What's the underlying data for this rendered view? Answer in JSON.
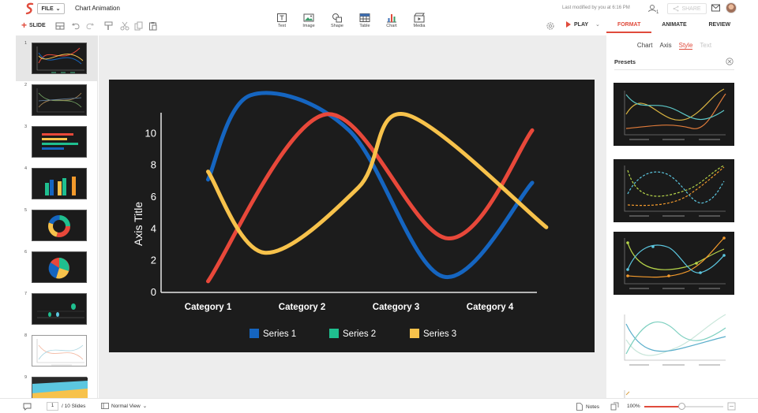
{
  "app": {
    "file_label": "FILE",
    "doc_title": "Chart Animation",
    "last_modified": "Last modified by you at 6:16 PM",
    "collaborator_count": "1",
    "share_label": "SHARE"
  },
  "toolbar": {
    "slide_label": "SLIDE",
    "play_label": "PLAY",
    "insert": [
      {
        "id": "text",
        "label": "Text",
        "icon": "text-icon"
      },
      {
        "id": "image",
        "label": "Image",
        "icon": "image-icon"
      },
      {
        "id": "shape",
        "label": "Shape",
        "icon": "shape-icon"
      },
      {
        "id": "table",
        "label": "Table",
        "icon": "table-icon"
      },
      {
        "id": "chart",
        "label": "Chart",
        "icon": "chart-icon"
      },
      {
        "id": "media",
        "label": "Media",
        "icon": "media-icon"
      }
    ]
  },
  "right_tabs": [
    {
      "label": "FORMAT",
      "active": true
    },
    {
      "label": "ANIMATE",
      "active": false
    },
    {
      "label": "REVIEW",
      "active": false
    }
  ],
  "format_subtabs": [
    {
      "label": "Chart",
      "state": "normal"
    },
    {
      "label": "Axis",
      "state": "normal"
    },
    {
      "label": "Style",
      "state": "active"
    },
    {
      "label": "Text",
      "state": "disabled"
    }
  ],
  "presets_title": "Presets",
  "slides": [
    {
      "num": "1",
      "kind": "line",
      "active": true
    },
    {
      "num": "2",
      "kind": "line-dim",
      "active": false
    },
    {
      "num": "3",
      "kind": "hbar",
      "active": false
    },
    {
      "num": "4",
      "kind": "vbar",
      "active": false
    },
    {
      "num": "5",
      "kind": "donut",
      "active": false
    },
    {
      "num": "6",
      "kind": "pie",
      "active": false
    },
    {
      "num": "7",
      "kind": "dots",
      "active": false
    },
    {
      "num": "8",
      "kind": "light-line",
      "active": false
    },
    {
      "num": "9",
      "kind": "area",
      "active": false
    }
  ],
  "status": {
    "page_current": "1",
    "page_total": "/ 10 Slides",
    "view_mode": "Normal View",
    "notes_label": "Notes",
    "zoom": "100%",
    "zoom_fraction": 0.47
  },
  "colors": {
    "accent": "#e04b3c",
    "series1": "#1565c0",
    "series2": "#1fbf8f",
    "series3": "#f7c24b",
    "series_red": "#e8483a"
  },
  "chart_data": {
    "type": "line",
    "categories": [
      "Category 1",
      "Category 2",
      "Category 3",
      "Category 4"
    ],
    "ylabel": "Axis Title",
    "xlabel": "",
    "yticks": [
      0,
      2,
      4,
      6,
      8,
      10
    ],
    "ylim": [
      0,
      12
    ],
    "legend": [
      {
        "name": "Series 1",
        "color": "#1565c0"
      },
      {
        "name": "Series 2",
        "color": "#1fbf8f"
      },
      {
        "name": "Series 3",
        "color": "#f7c24b"
      }
    ],
    "legend_position": "bottom",
    "curves": [
      {
        "color": "#1565c0",
        "points": [
          [
            0,
            7.1
          ],
          [
            0.45,
            12.4
          ],
          [
            1.5,
            10.2
          ],
          [
            2.5,
            1.0
          ],
          [
            3.45,
            6.9
          ]
        ]
      },
      {
        "color": "#e8483a",
        "points": [
          [
            0,
            0.7
          ],
          [
            1.25,
            11.2
          ],
          [
            2.55,
            3.4
          ],
          [
            3.45,
            10.2
          ]
        ]
      },
      {
        "color": "#f7c24b",
        "points": [
          [
            0,
            7.6
          ],
          [
            0.6,
            2.5
          ],
          [
            1.6,
            6.6
          ],
          [
            2.1,
            11.2
          ],
          [
            3.6,
            4.1
          ]
        ]
      }
    ]
  }
}
